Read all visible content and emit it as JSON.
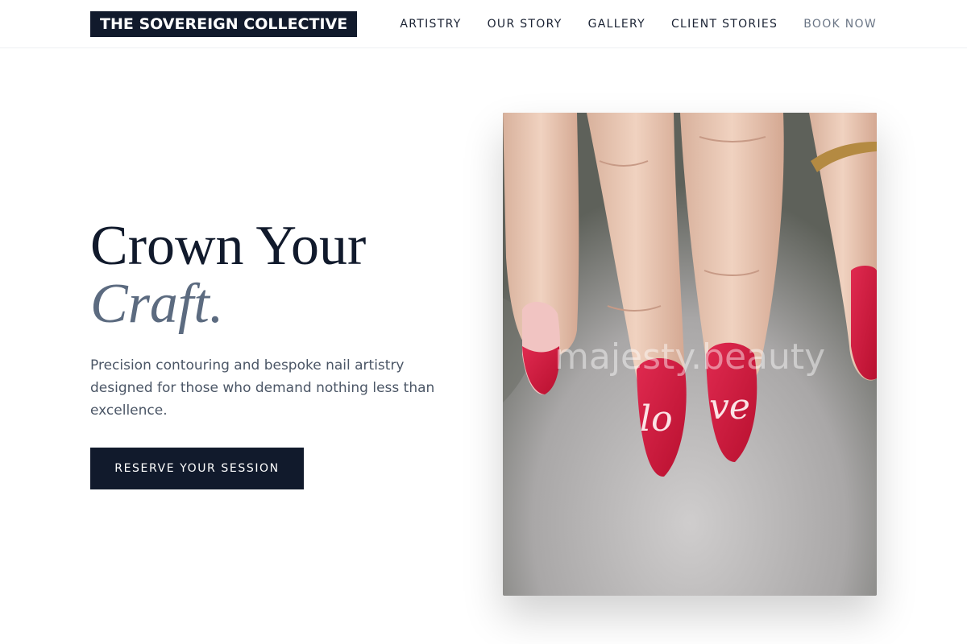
{
  "header": {
    "logo": "THE SOVEREIGN COLLECTIVE",
    "nav": [
      "ARTISTRY",
      "OUR STORY",
      "GALLERY",
      "CLIENT STORIES",
      "BOOK NOW"
    ]
  },
  "hero": {
    "title_line1": "Crown Your",
    "title_line2": "Craft.",
    "description": "Precision contouring and bespoke nail artistry designed for those who demand nothing less than excellence.",
    "cta": "RESERVE YOUR SESSION"
  },
  "image": {
    "subject": "hand with red almond nails spelling love",
    "watermark": "majesty.beauty",
    "nail_text_left": "lo",
    "nail_text_right": "ve"
  },
  "colors": {
    "primary": "#111a2c",
    "accent_slate": "#5c6b80",
    "nail_red": "#d1173f"
  }
}
